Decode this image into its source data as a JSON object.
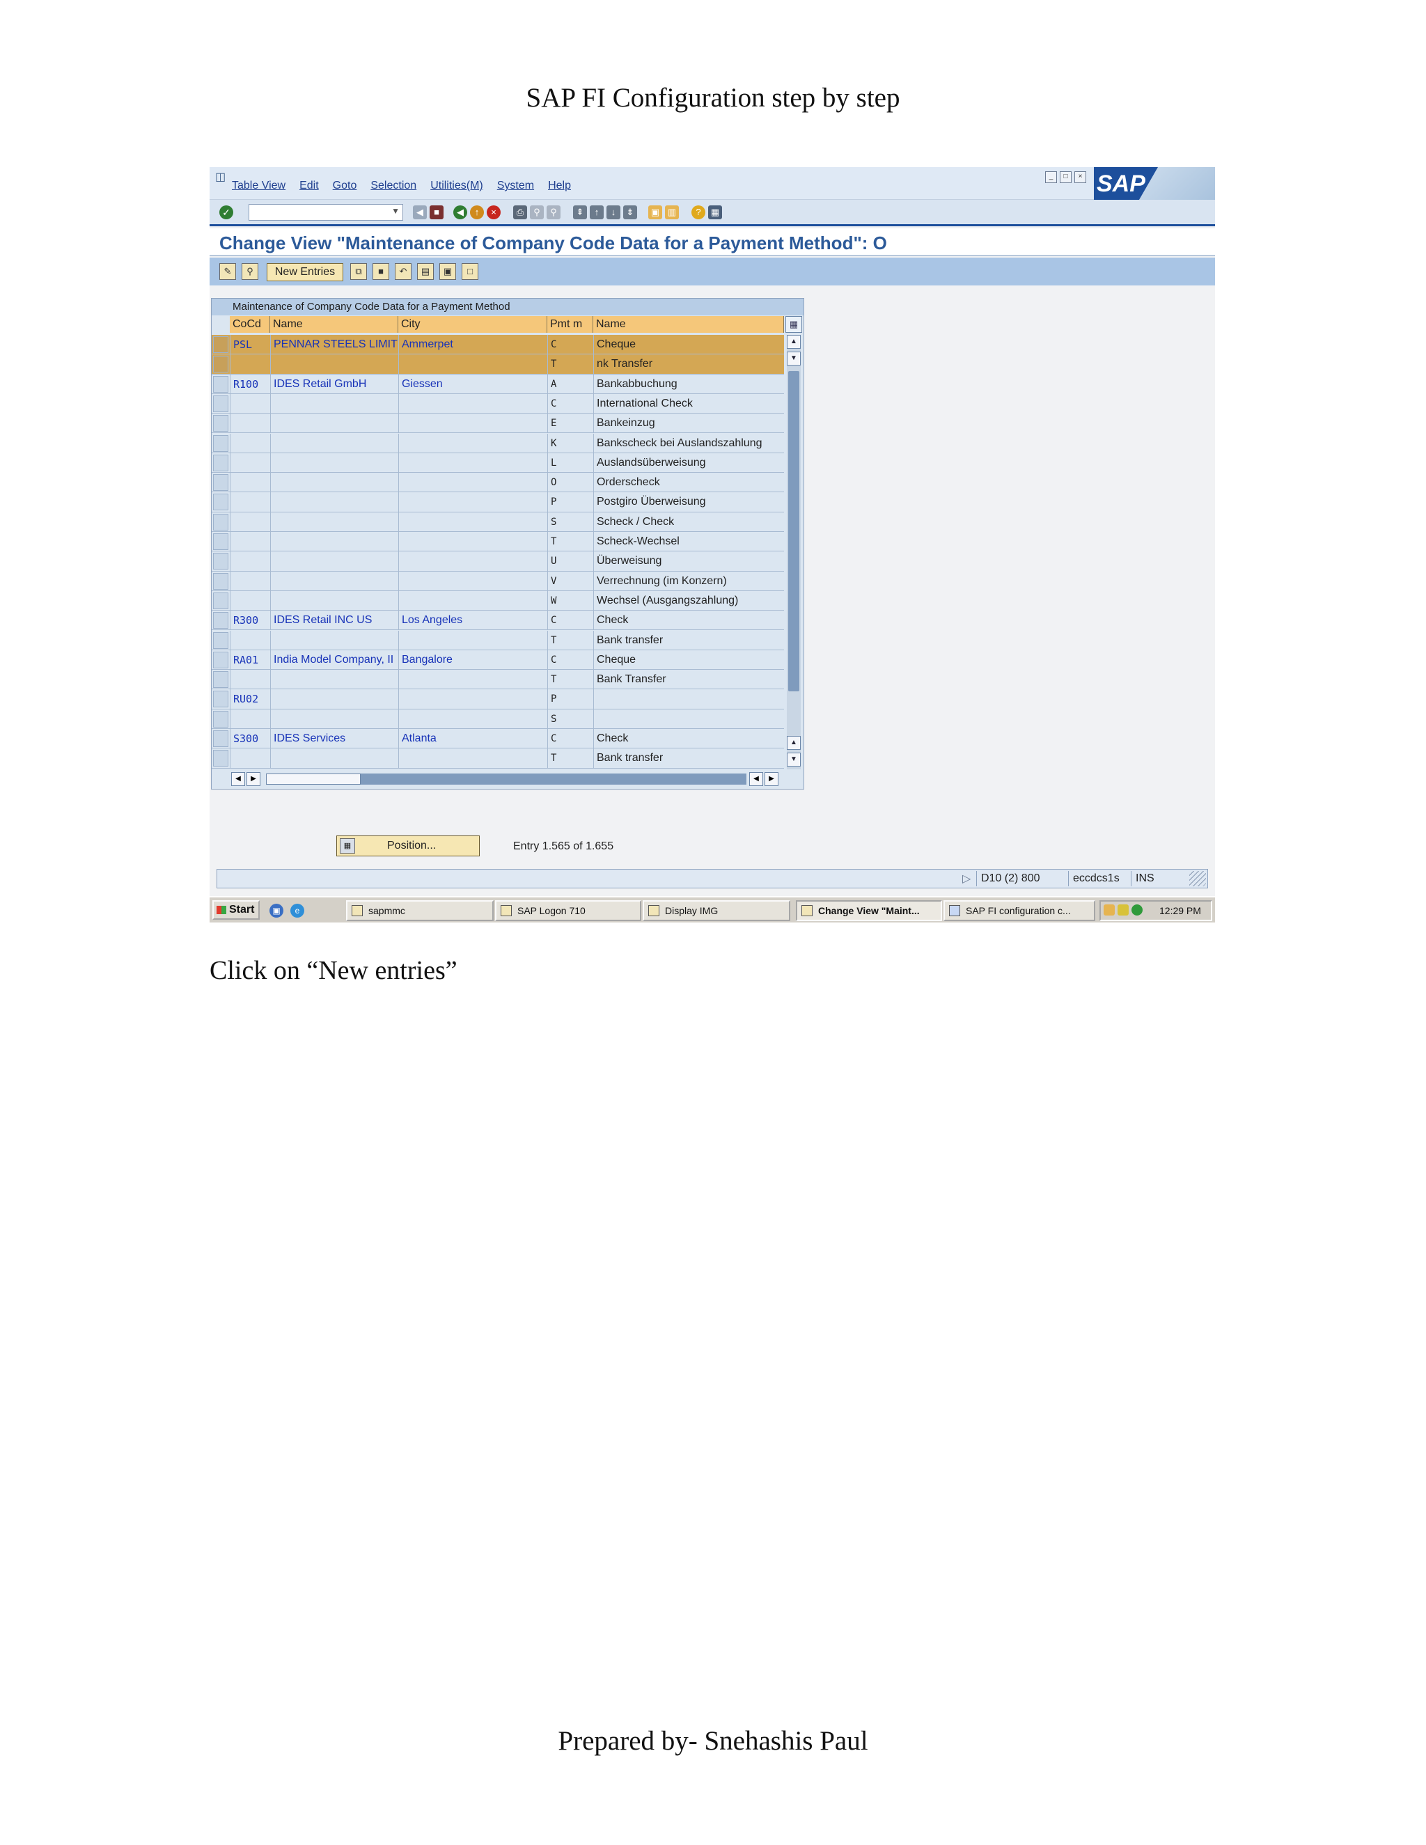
{
  "document": {
    "title": "SAP FI Configuration step by step",
    "instruction": "Click on “New entries”",
    "footer": "Prepared by- Snehashis Paul"
  },
  "sap": {
    "menus": [
      "Table View",
      "Edit",
      "Goto",
      "Selection",
      "Utilities(M)",
      "System",
      "Help"
    ],
    "logo": "SAP",
    "screen_title": "Change View \"Maintenance of Company Code Data for a Payment Method\": O",
    "app_toolbar": {
      "new_entries_label": "New Entries"
    },
    "table": {
      "caption": "Maintenance of Company Code Data for a Payment Method",
      "headers": [
        "CoCd",
        "Name",
        "City",
        "Pmt m",
        "Name"
      ],
      "rows": [
        {
          "cocd": "PSL",
          "name": "PENNAR STEELS LIMIT",
          "city": "Ammerpet",
          "pm": "C",
          "pm_name": "Cheque"
        },
        {
          "cocd": "",
          "name": "",
          "city": "",
          "pm": "T",
          "pm_name": "nk Transfer"
        },
        {
          "cocd": "R100",
          "name": "IDES Retail GmbH",
          "city": "Giessen",
          "pm": "A",
          "pm_name": "Bankabbuchung"
        },
        {
          "cocd": "",
          "name": "",
          "city": "",
          "pm": "C",
          "pm_name": "International Check"
        },
        {
          "cocd": "",
          "name": "",
          "city": "",
          "pm": "E",
          "pm_name": "Bankeinzug"
        },
        {
          "cocd": "",
          "name": "",
          "city": "",
          "pm": "K",
          "pm_name": "Bankscheck bei Auslandszahlung"
        },
        {
          "cocd": "",
          "name": "",
          "city": "",
          "pm": "L",
          "pm_name": "Auslandsüberweisung"
        },
        {
          "cocd": "",
          "name": "",
          "city": "",
          "pm": "O",
          "pm_name": "Orderscheck"
        },
        {
          "cocd": "",
          "name": "",
          "city": "",
          "pm": "P",
          "pm_name": "Postgiro Überweisung"
        },
        {
          "cocd": "",
          "name": "",
          "city": "",
          "pm": "S",
          "pm_name": "Scheck / Check"
        },
        {
          "cocd": "",
          "name": "",
          "city": "",
          "pm": "T",
          "pm_name": "Scheck-Wechsel"
        },
        {
          "cocd": "",
          "name": "",
          "city": "",
          "pm": "U",
          "pm_name": "Überweisung"
        },
        {
          "cocd": "",
          "name": "",
          "city": "",
          "pm": "V",
          "pm_name": "Verrechnung (im Konzern)"
        },
        {
          "cocd": "",
          "name": "",
          "city": "",
          "pm": "W",
          "pm_name": "Wechsel (Ausgangszahlung)"
        },
        {
          "cocd": "R300",
          "name": "IDES Retail INC US",
          "city": "Los Angeles",
          "pm": "C",
          "pm_name": "Check"
        },
        {
          "cocd": "",
          "name": "",
          "city": "",
          "pm": "T",
          "pm_name": "Bank transfer"
        },
        {
          "cocd": "RA01",
          "name": "India Model Company, II",
          "city": "Bangalore",
          "pm": "C",
          "pm_name": "Cheque"
        },
        {
          "cocd": "",
          "name": "",
          "city": "",
          "pm": "T",
          "pm_name": "Bank Transfer"
        },
        {
          "cocd": "RU02",
          "name": "",
          "city": "",
          "pm": "P",
          "pm_name": ""
        },
        {
          "cocd": "",
          "name": "",
          "city": "",
          "pm": "S",
          "pm_name": ""
        },
        {
          "cocd": "S300",
          "name": "IDES Services",
          "city": "Atlanta",
          "pm": "C",
          "pm_name": "Check"
        },
        {
          "cocd": "",
          "name": "",
          "city": "",
          "pm": "T",
          "pm_name": "Bank transfer"
        }
      ]
    },
    "position_button": "Position...",
    "entry_text": "Entry 1.565 of 1.655",
    "status": {
      "system": "D10 (2) 800",
      "server": "eccdcs1s",
      "mode": "INS"
    }
  },
  "taskbar": {
    "start": "Start",
    "buttons": [
      "sapmmc",
      "SAP Logon 710",
      "Display IMG",
      "Change View \"Maint...",
      "SAP FI configuration c..."
    ],
    "time": "12:29 PM"
  },
  "colors": {
    "sap_blue": "#1d4f9c",
    "highlight_row": "#d4a754",
    "header_orange": "#f5c77a",
    "link_blue": "#1833b8"
  }
}
